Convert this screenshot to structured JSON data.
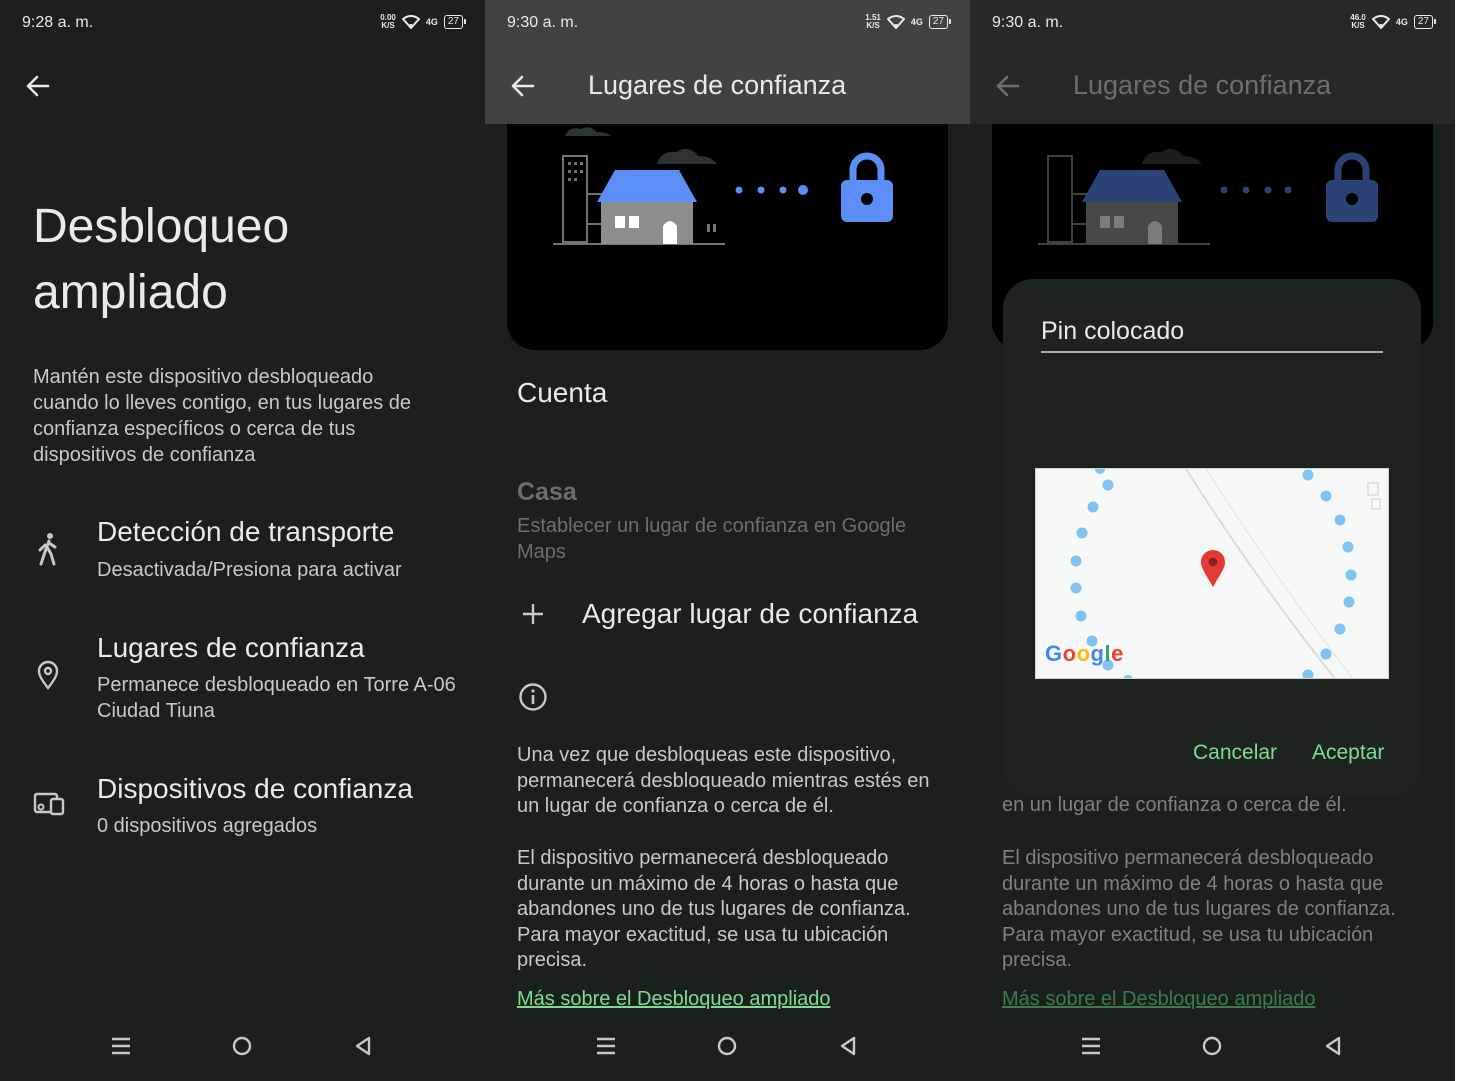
{
  "screen1": {
    "status": {
      "time": "9:28 a. m.",
      "speed_value": "0.00",
      "speed_unit": "K/S",
      "network": "4G",
      "battery": "27"
    },
    "title_line1": "Desbloqueo",
    "title_line2": "ampliado",
    "description": "Mantén este dispositivo desbloqueado cuando lo lleves contigo, en tus lugares de confianza específicos o cerca de tus dispositivos de confianza",
    "items": [
      {
        "title": "Detección de transporte",
        "subtitle": "Desactivada/Presiona para activar",
        "icon": "walking-person-icon"
      },
      {
        "title": "Lugares de confianza",
        "subtitle": "Permanece desbloqueado en Torre A-06 Ciudad Tiuna",
        "icon": "location-pin-icon"
      },
      {
        "title": "Dispositivos de confianza",
        "subtitle": "0 dispositivos agregados",
        "icon": "devices-icon"
      }
    ]
  },
  "screen2": {
    "status": {
      "time": "9:30 a. m.",
      "speed_value": "1.51",
      "speed_unit": "K/S",
      "network": "4G",
      "battery": "27"
    },
    "appbar_title": "Lugares de confianza",
    "section_title": "Cuenta",
    "home_title": "Casa",
    "home_subtitle": "Establecer un lugar de confianza en Google Maps",
    "add_label": "Agregar lugar de confianza",
    "info_text_1": "Una vez que desbloqueas este dispositivo, permanecerá desbloqueado mientras estés en un lugar de confianza o cerca de él.",
    "info_text_2": "El dispositivo permanecerá desbloqueado durante un máximo de 4 horas o hasta que abandones uno de tus lugares de confianza. Para mayor exactitud, se usa tu ubicación precisa.",
    "link": "Más sobre el Desbloqueo ampliado"
  },
  "screen3": {
    "status": {
      "time": "9:30 a. m.",
      "speed_value": "46.0",
      "speed_unit": "K/S",
      "network": "4G",
      "battery": "27"
    },
    "appbar_title": "Lugares de confianza",
    "bg_text_partial": "en un lugar de confianza o cerca de él.",
    "info_text_2": "El dispositivo permanecerá desbloqueado durante un máximo de 4 horas o hasta que abandones uno de tus lugares de confianza. Para mayor exactitud, se usa tu ubicación precisa.",
    "link": "Más sobre el Desbloqueo ampliado",
    "dialog": {
      "title": "Pin colocado",
      "map_brand": "Google",
      "cancel": "Cancelar",
      "accept": "Aceptar"
    }
  },
  "colors": {
    "accent": "#7fdc95",
    "lock_blue": "#5b8ff5",
    "background": "#1a201c",
    "appbar": "#3e4540"
  }
}
